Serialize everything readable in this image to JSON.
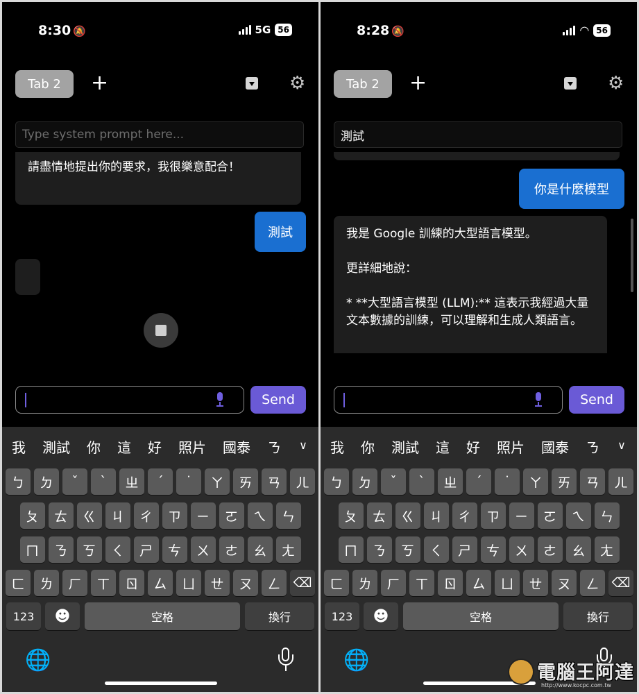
{
  "left": {
    "status": {
      "time": "8:30",
      "network": "5G",
      "battery": "56"
    },
    "tab_label": "Tab 2",
    "system_prompt": {
      "placeholder": "Type system prompt here...",
      "value": ""
    },
    "messages": {
      "bot_1": "請盡情地提出你的要求，我很樂意配合！",
      "user_1": "測試"
    },
    "send_label": "Send",
    "candidates": [
      "我",
      "測試",
      "你",
      "這",
      "好",
      "照片",
      "國泰",
      "ㄋ"
    ]
  },
  "right": {
    "status": {
      "time": "8:28",
      "battery": "56"
    },
    "tab_label": "Tab 2",
    "system_prompt": {
      "placeholder": "Type system prompt here...",
      "value": "測試"
    },
    "messages": {
      "user_1": "你是什麼模型",
      "bot_1": [
        "我是 Google 訓練的大型語言模型。",
        "",
        "更詳細地說：",
        "",
        "*   **大型語言模型 (LLM):** 這表示我經過大量文本數據的訓練，可以理解和生成人類語言。"
      ]
    },
    "send_label": "Send",
    "candidates": [
      "我",
      "你",
      "測試",
      "這",
      "好",
      "照片",
      "國泰",
      "ㄋ"
    ]
  },
  "keyboard": {
    "row1": [
      "ㄅ",
      "ㄉ",
      "ˇ",
      "ˋ",
      "ㄓ",
      "ˊ",
      "˙",
      "ㄚ",
      "ㄞ",
      "ㄢ",
      "ㄦ"
    ],
    "row2": [
      "ㄆ",
      "ㄊ",
      "ㄍ",
      "ㄐ",
      "ㄔ",
      "ㄗ",
      "ㄧ",
      "ㄛ",
      "ㄟ",
      "ㄣ"
    ],
    "row3": [
      "ㄇ",
      "ㄋ",
      "ㄎ",
      "ㄑ",
      "ㄕ",
      "ㄘ",
      "ㄨ",
      "ㄜ",
      "ㄠ",
      "ㄤ"
    ],
    "row4": [
      "ㄈ",
      "ㄌ",
      "ㄏ",
      "ㄒ",
      "ㄖ",
      "ㄙ",
      "ㄩ",
      "ㄝ",
      "ㄡ",
      "ㄥ"
    ],
    "numbers_label": "123",
    "space_label": "空格",
    "return_label": "換行",
    "delete_glyph": "⌫",
    "emoji_glyph": "☻",
    "globe_glyph": "🌐",
    "expand_glyph": "∨"
  },
  "icons": {
    "mute": "bell-slash-icon",
    "signal": "cellular-signal-icon",
    "wifi": "wifi-icon",
    "battery": "battery-icon",
    "add": "plus-icon",
    "export": "download-icon",
    "settings": "gear-icon",
    "stop": "stop-icon",
    "mic": "microphone-icon"
  },
  "colors": {
    "send": "#6a5ad6",
    "user_bubble": "#1a6fd1",
    "bot_bubble": "#1e1e1e",
    "tab_chip": "#a3a3a3"
  },
  "watermark": {
    "text": "電腦王阿達",
    "url": "http://www.kocpc.com.tw"
  }
}
